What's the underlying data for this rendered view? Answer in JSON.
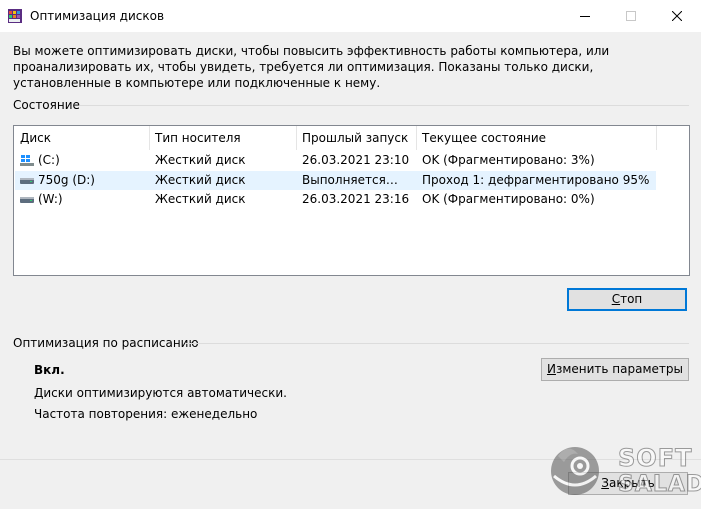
{
  "window": {
    "title": "Оптимизация дисков"
  },
  "intro": "Вы можете оптимизировать диски, чтобы повысить эффективность работы  компьютера, или проанализировать их, чтобы увидеть, требуется ли оптимизация. Показаны только диски, установленные в компьютере или подключенные к нему.",
  "status_section": {
    "label": "Состояние",
    "columns": [
      "Диск",
      "Тип носителя",
      "Прошлый запуск",
      "Текущее состояние"
    ],
    "rows": [
      {
        "disk": "(C:)",
        "media": "Жесткий диск",
        "last_run": "26.03.2021 23:10",
        "state": "OK (Фрагментировано: 3%)",
        "icon": "windows-drive-icon"
      },
      {
        "disk": "750g (D:)",
        "media": "Жесткий диск",
        "last_run": "Выполняется…",
        "state": "Проход 1: дефрагментировано 95%",
        "icon": "hard-drive-icon"
      },
      {
        "disk": "(W:)",
        "media": "Жесткий диск",
        "last_run": "26.03.2021 23:16",
        "state": "OK (Фрагментировано: 0%)",
        "icon": "hard-drive-icon"
      }
    ],
    "stop_button_pre": "",
    "stop_button_accel": "С",
    "stop_button_post": "топ"
  },
  "schedule_section": {
    "label": "Оптимизация по расписанию",
    "state": "Вкл.",
    "description": "Диски оптимизируются автоматически.",
    "frequency": "Частота повторения: еженедельно",
    "change_button_pre": "",
    "change_button_accel": "И",
    "change_button_post": "зменить параметры"
  },
  "footer": {
    "close_button_pre": "",
    "close_button_accel": "З",
    "close_button_post": "акрыть"
  },
  "watermark": {
    "line1": "SOFT",
    "line2": "SALAD"
  },
  "colors": {
    "selection": "#e5f3ff",
    "focus": "#0078d7"
  }
}
